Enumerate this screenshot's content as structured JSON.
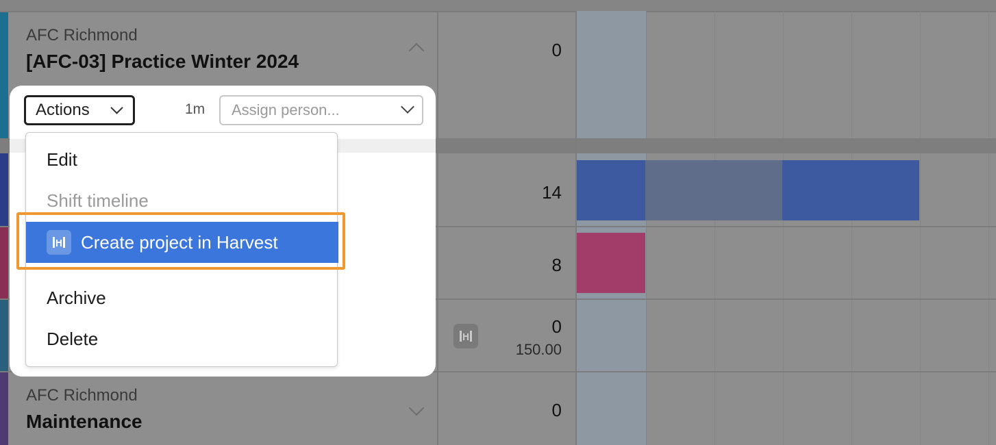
{
  "rows": [
    {
      "client": "AFC Richmond",
      "project": "[AFC-03] Practice Winter 2024",
      "total": "0",
      "color": "#1d6f8f"
    },
    {
      "total": "14",
      "color": "#2a3d86"
    },
    {
      "total": "8",
      "color": "#8a2f54"
    },
    {
      "total": "0",
      "sub": "150.00",
      "color": "#2a5f7e"
    },
    {
      "client": "AFC Richmond",
      "project": "Maintenance",
      "total": "0",
      "color": "#503a72"
    }
  ],
  "toolbar": {
    "actions_label": "Actions",
    "duration": "1m",
    "assign_placeholder": "Assign person..."
  },
  "actions_menu": {
    "items": [
      {
        "label": "Edit",
        "state": "enabled"
      },
      {
        "label": "Shift timeline",
        "state": "disabled"
      },
      {
        "label": "Create project in Harvest",
        "state": "highlighted",
        "icon": "harvest-icon"
      },
      {
        "label": "Archive",
        "state": "enabled"
      },
      {
        "label": "Delete",
        "state": "enabled"
      }
    ]
  },
  "colors": {
    "bar_blue": "#3d5aa0",
    "bar_blue_light": "#5f6d8a",
    "bar_pink": "#a13d68",
    "menu_highlight": "#3a76db",
    "callout_orange": "#f0972f"
  }
}
